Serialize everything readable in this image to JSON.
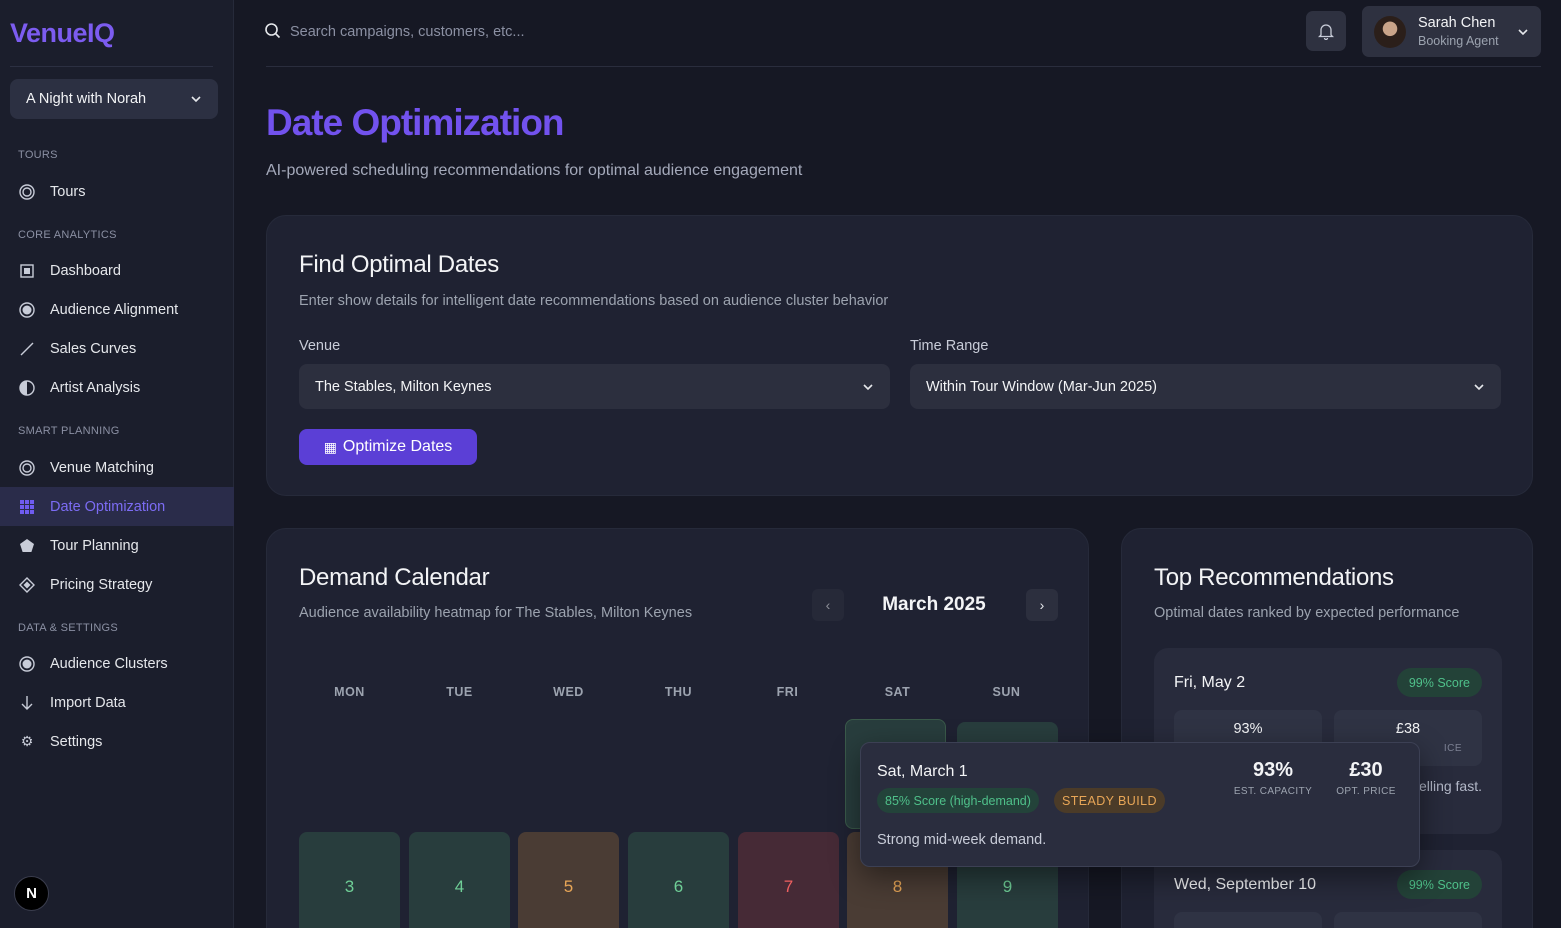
{
  "app": {
    "logo": "VenueIQ"
  },
  "sidebar": {
    "project": "A Night with Norah",
    "sections": {
      "tours": "TOURS",
      "core": "CORE ANALYTICS",
      "smart": "SMART PLANNING",
      "data": "DATA & SETTINGS"
    },
    "items": {
      "tours": "Tours",
      "dashboard": "Dashboard",
      "audience_alignment": "Audience Alignment",
      "sales_curves": "Sales Curves",
      "artist_analysis": "Artist Analysis",
      "venue_matching": "Venue Matching",
      "date_optimization": "Date Optimization",
      "tour_planning": "Tour Planning",
      "pricing_strategy": "Pricing Strategy",
      "audience_clusters": "Audience Clusters",
      "import_data": "Import Data",
      "settings": "Settings"
    },
    "active": "date_optimization",
    "badge": "N"
  },
  "header": {
    "search_placeholder": "Search campaigns, customers, etc...",
    "user": {
      "name": "Sarah Chen",
      "role": "Booking Agent"
    }
  },
  "page": {
    "title": "Date Optimization",
    "subtitle": "AI-powered scheduling recommendations for optimal audience engagement"
  },
  "finder": {
    "title": "Find Optimal Dates",
    "subtitle": "Enter show details for intelligent date recommendations based on audience cluster behavior",
    "venue_label": "Venue",
    "venue_value": "The Stables, Milton Keynes",
    "range_label": "Time Range",
    "range_value": "Within Tour Window (Mar-Jun 2025)",
    "button_icon": "▦",
    "button_label": "Optimize Dates"
  },
  "calendar": {
    "title": "Demand Calendar",
    "subtitle": "Audience availability heatmap for The Stables, Milton Keynes",
    "month": "March 2025",
    "prev": "‹",
    "next": "›",
    "weekdays": [
      "MON",
      "TUE",
      "WED",
      "THU",
      "FRI",
      "SAT",
      "SUN"
    ],
    "week2": [
      {
        "day": "3",
        "level": "green"
      },
      {
        "day": "4",
        "level": "green"
      },
      {
        "day": "5",
        "level": "amber"
      },
      {
        "day": "6",
        "level": "green"
      },
      {
        "day": "7",
        "level": "red"
      },
      {
        "day": "8",
        "level": "amber"
      },
      {
        "day": "9",
        "level": "green"
      }
    ]
  },
  "tooltip": {
    "date": "Sat, March 1",
    "score": "85% Score (high-demand)",
    "trend": "STEADY BUILD",
    "capacity_value": "93%",
    "capacity_label": "EST. CAPACITY",
    "price_value": "£30",
    "price_label": "OPT. PRICE",
    "note": "Strong mid-week demand."
  },
  "recommendations": {
    "title": "Top Recommendations",
    "subtitle": "Optimal dates ranked by expected performance",
    "items": [
      {
        "date": "Fri, May 2",
        "score": "99% Score",
        "capacity": "93%",
        "price": "£38",
        "price_label": "ICE",
        "note": "elling fast."
      },
      {
        "date": "Wed, September 10",
        "score": "99% Score"
      }
    ]
  },
  "colors": {
    "accent": "#7252ee",
    "high": "#4fc08a",
    "medium": "#e8a657",
    "low": "#ef6060"
  }
}
